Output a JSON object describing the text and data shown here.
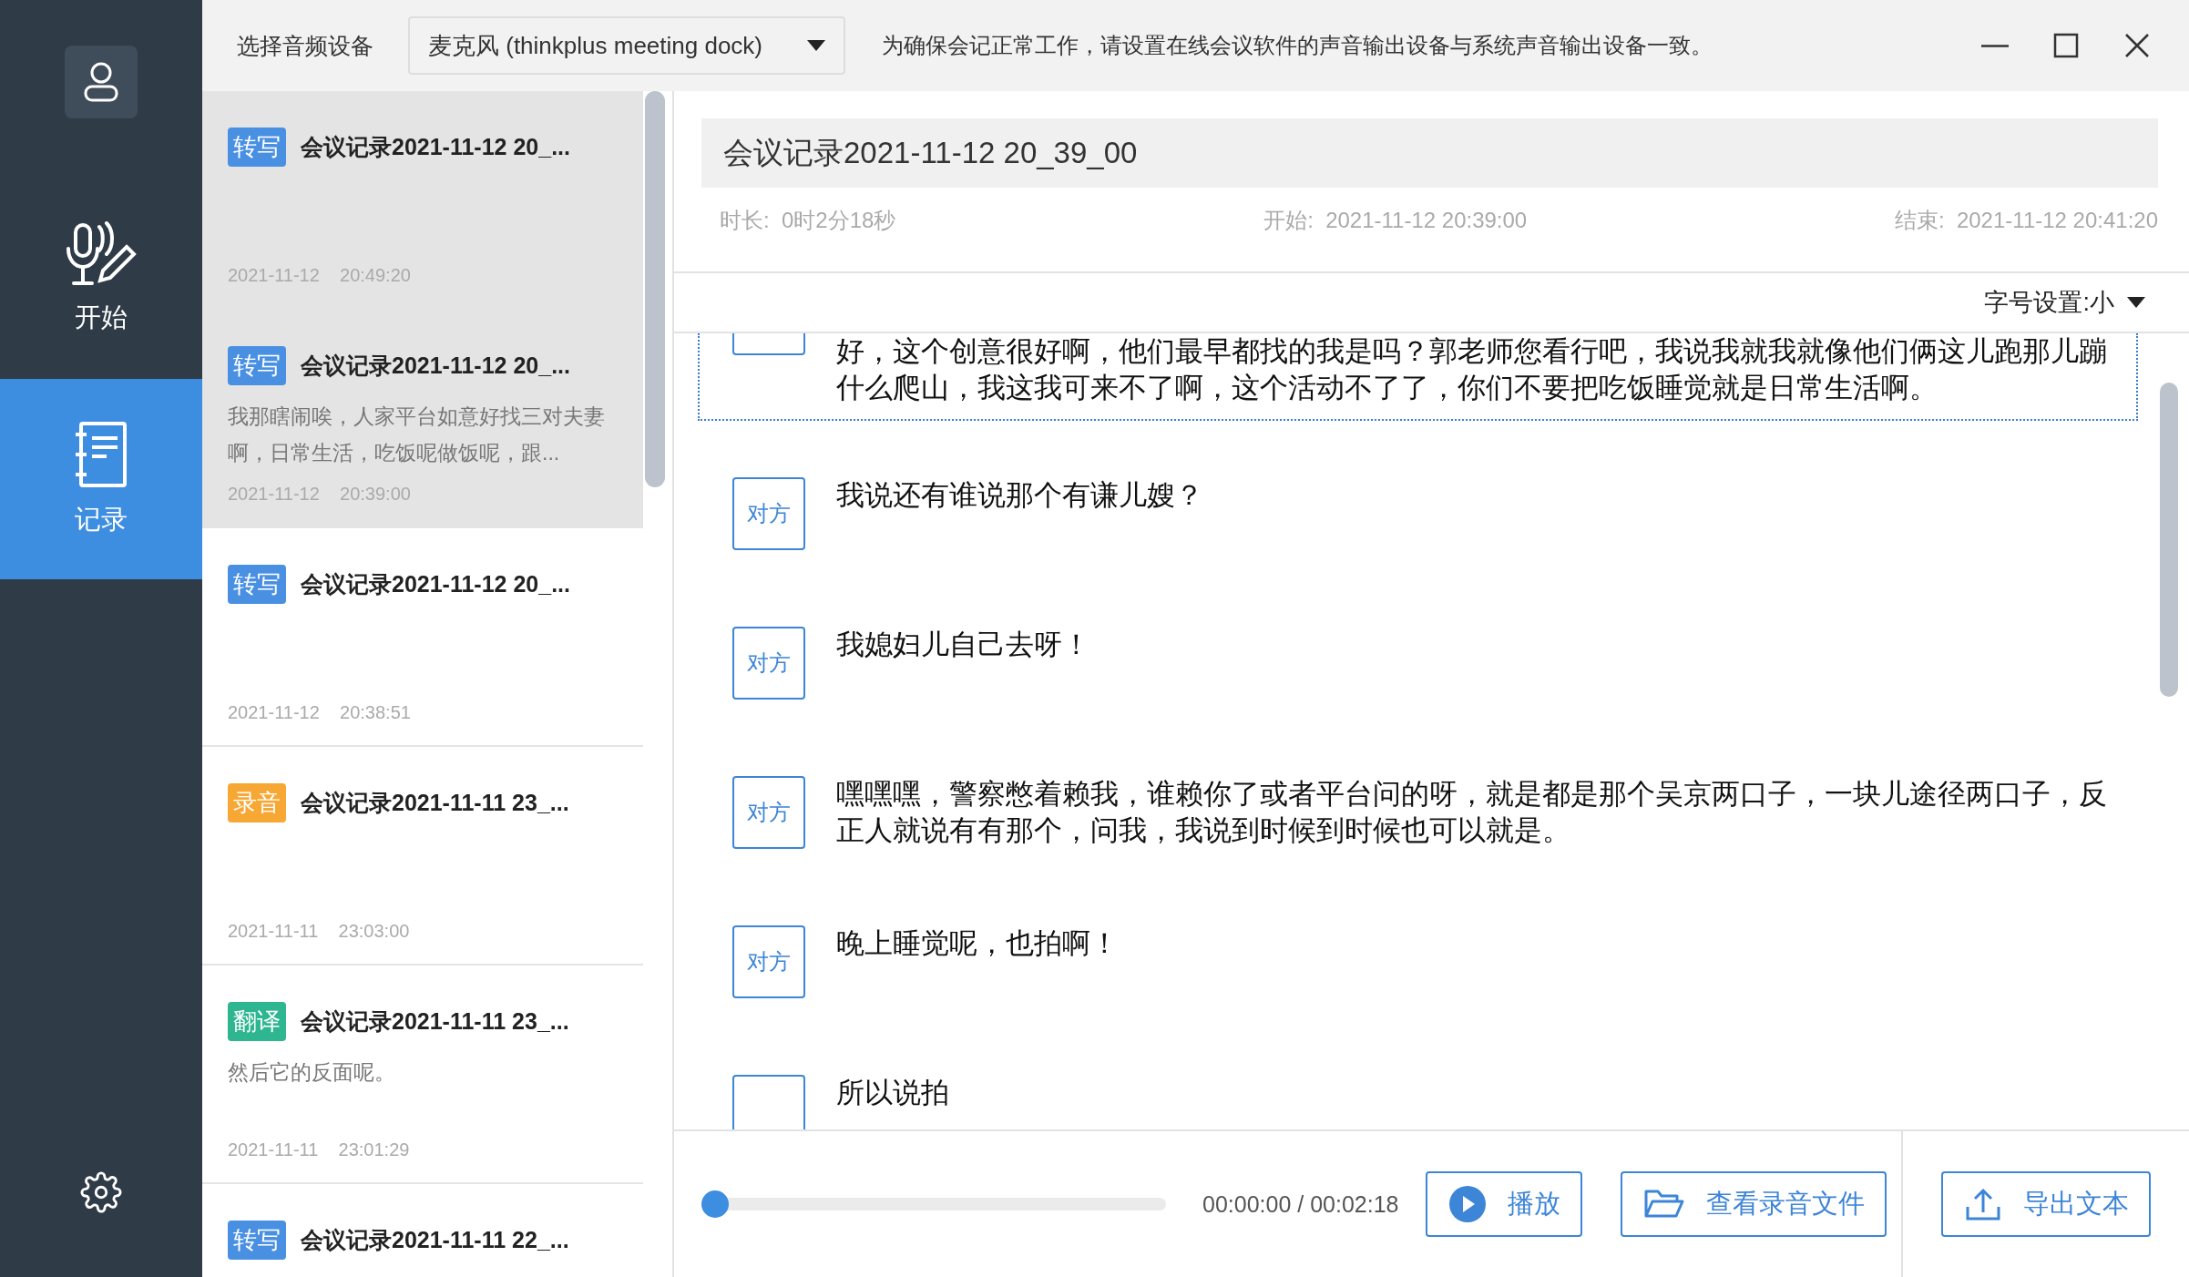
{
  "toolbar": {
    "device_label": "选择音频设备",
    "device_select": {
      "value": "麦克风 (thinkplus meeting dock)"
    },
    "notice": "为确保会记正常工作，请设置在线会议软件的声音输出设备与系统声音输出设备一致。"
  },
  "sidebar": {
    "items": [
      {
        "kind": "avatar"
      },
      {
        "kind": "nav",
        "label": "开始",
        "selected": false
      },
      {
        "kind": "nav",
        "label": "记录",
        "selected": true
      },
      {
        "kind": "settings"
      }
    ]
  },
  "records": [
    {
      "tag": "转写",
      "color": "#4a90e2",
      "title": "会议记录2021-11-12 20_...",
      "date": "2021-11-12",
      "time": "20:49:20",
      "selected": true
    },
    {
      "tag": "转写",
      "color": "#4a90e2",
      "title": "会议记录2021-11-12 20_...",
      "snippet": "我那瞎闹唉，人家平台如意好找三对夫妻啊，日常生活，吃饭呢做饭呢，跟...",
      "date": "2021-11-12",
      "time": "20:39:00",
      "selected": true
    },
    {
      "tag": "转写",
      "color": "#4a90e2",
      "title": "会议记录2021-11-12 20_...",
      "date": "2021-11-12",
      "time": "20:38:51",
      "selected": false
    },
    {
      "tag": "录音",
      "color": "#f7a733",
      "title": "会议记录2021-11-11 23_...",
      "date": "2021-11-11",
      "time": "23:03:00",
      "selected": false
    },
    {
      "tag": "翻译",
      "color": "#2db690",
      "title": "会议记录2021-11-11 23_...",
      "snippet": "然后它的反面呢。",
      "date": "2021-11-11",
      "time": "23:01:29",
      "selected": false
    },
    {
      "tag": "转写",
      "color": "#4a90e2",
      "title": "会议记录2021-11-11 22_...",
      "selected": false
    }
  ],
  "detail": {
    "title": "会议记录2021-11-12 20_39_00",
    "meta": [
      {
        "label": "时长:",
        "value": "0时2分18秒"
      },
      {
        "label": "开始:",
        "value": "2021-11-12 20:39:00"
      },
      {
        "label": "结束:",
        "value": "2021-11-12 20:41:20"
      }
    ],
    "font_size": {
      "label": "字号设置:小"
    },
    "segments": [
      {
        "text": "好，这个创意很好啊，他们最早都找的我是吗？郭老师您看行吧，我说我就我就像他们俩这儿跑那儿蹦什么爬山，我这我可来不了啊，这个活动不了了，你们不要把吃饭睡觉就是日常生活啊。",
        "focused": true
      },
      {
        "speaker": "对方",
        "text": "我说还有谁说那个有谦儿嫂？",
        "focused": false
      },
      {
        "speaker": "对方",
        "text": "我媳妇儿自己去呀！",
        "focused": false
      },
      {
        "speaker": "对方",
        "text": "嘿嘿嘿，警察憋着赖我，谁赖你了或者平台问的呀，就是都是那个吴京两口子，一块儿途径两口子，反正人就说有有那个，问我，我说到时候到时候也可以就是。",
        "focused": false
      },
      {
        "speaker": "对方",
        "text": "晚上睡觉呢，也拍啊！",
        "focused": false
      },
      {
        "text": "所以说拍",
        "focused": false
      }
    ],
    "player": {
      "level": 0,
      "time": "00:00:00 / 00:02:18"
    },
    "buttons": [
      {
        "label": "播放"
      },
      {
        "label": "查看录音文件"
      },
      {
        "label": "导出文本"
      }
    ]
  }
}
